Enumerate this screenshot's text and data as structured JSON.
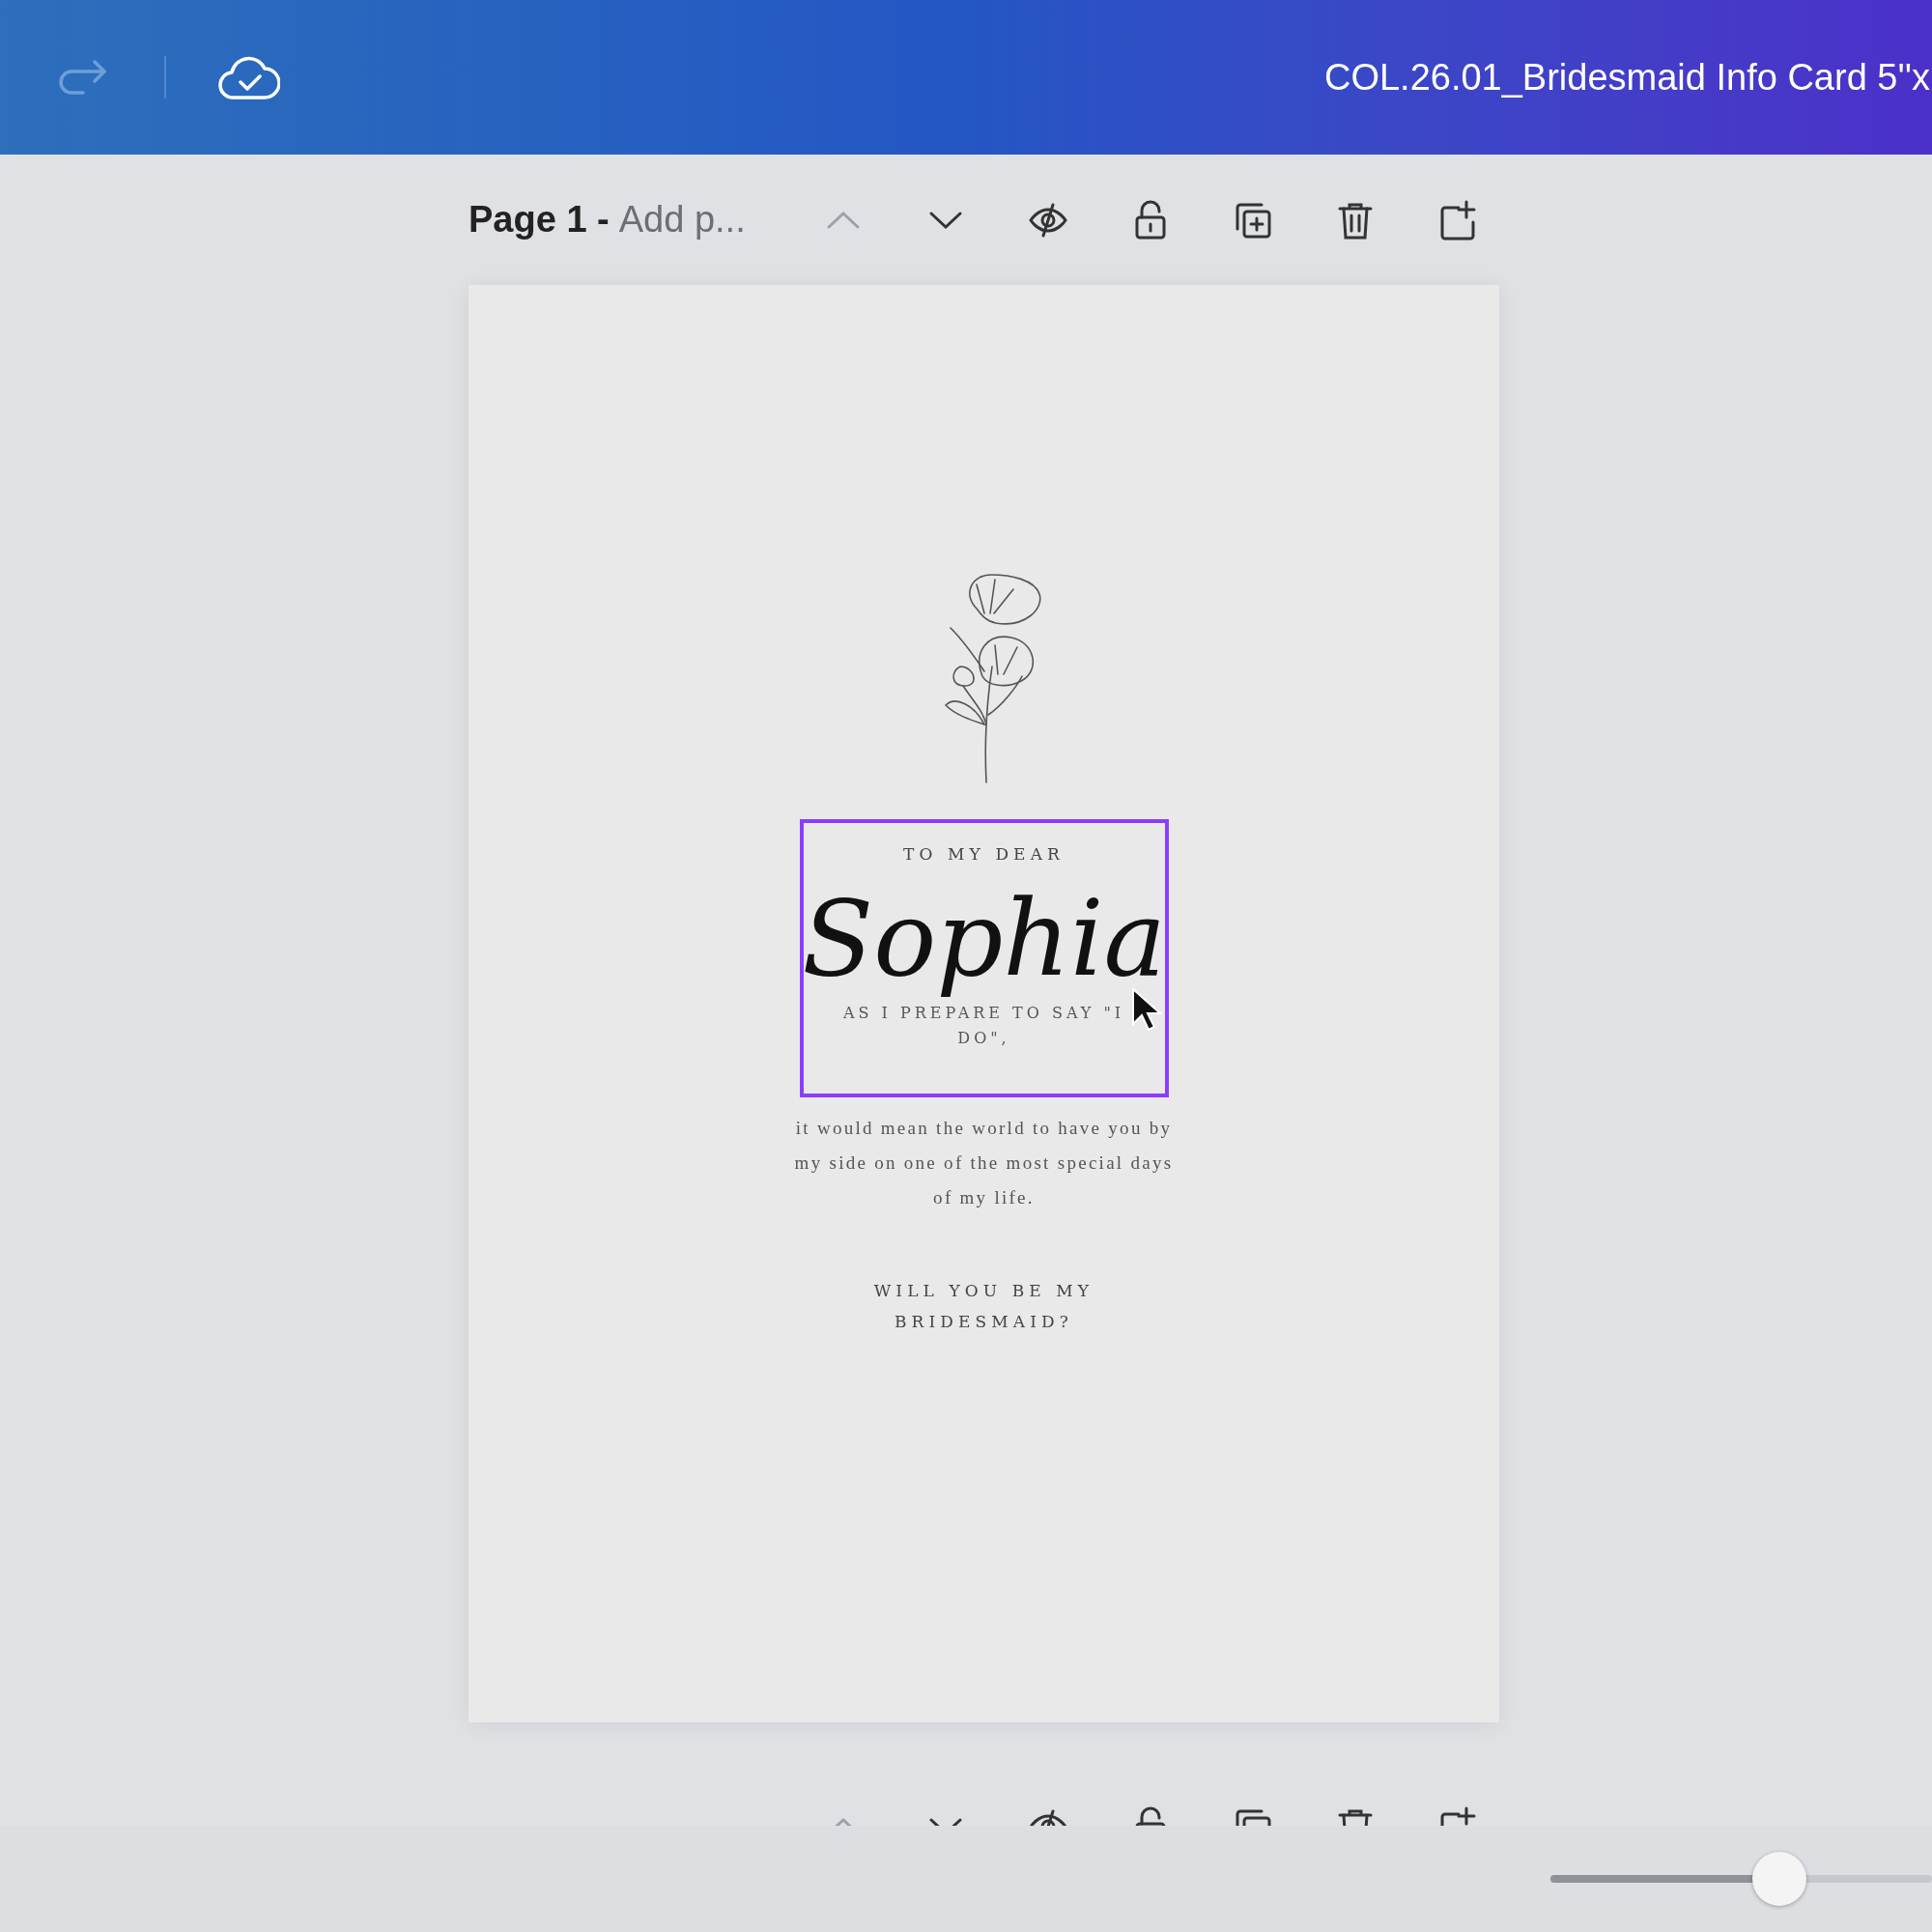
{
  "top_bar": {
    "title": "COL.26.01_Bridesmaid Info Card 5''x"
  },
  "page_header": {
    "label": "Page 1 -",
    "title": "Add p..."
  },
  "card": {
    "eyebrow": "TO MY DEAR",
    "name": "Sophia",
    "lead": "AS I PREPARE TO SAY \"I DO\",",
    "body": "it would mean the world to have you by my side on one of the most special days of my life.",
    "question": "WILL YOU BE MY BRIDESMAID?",
    "selected": true
  },
  "zoom_slider": {
    "level": 0.6
  }
}
